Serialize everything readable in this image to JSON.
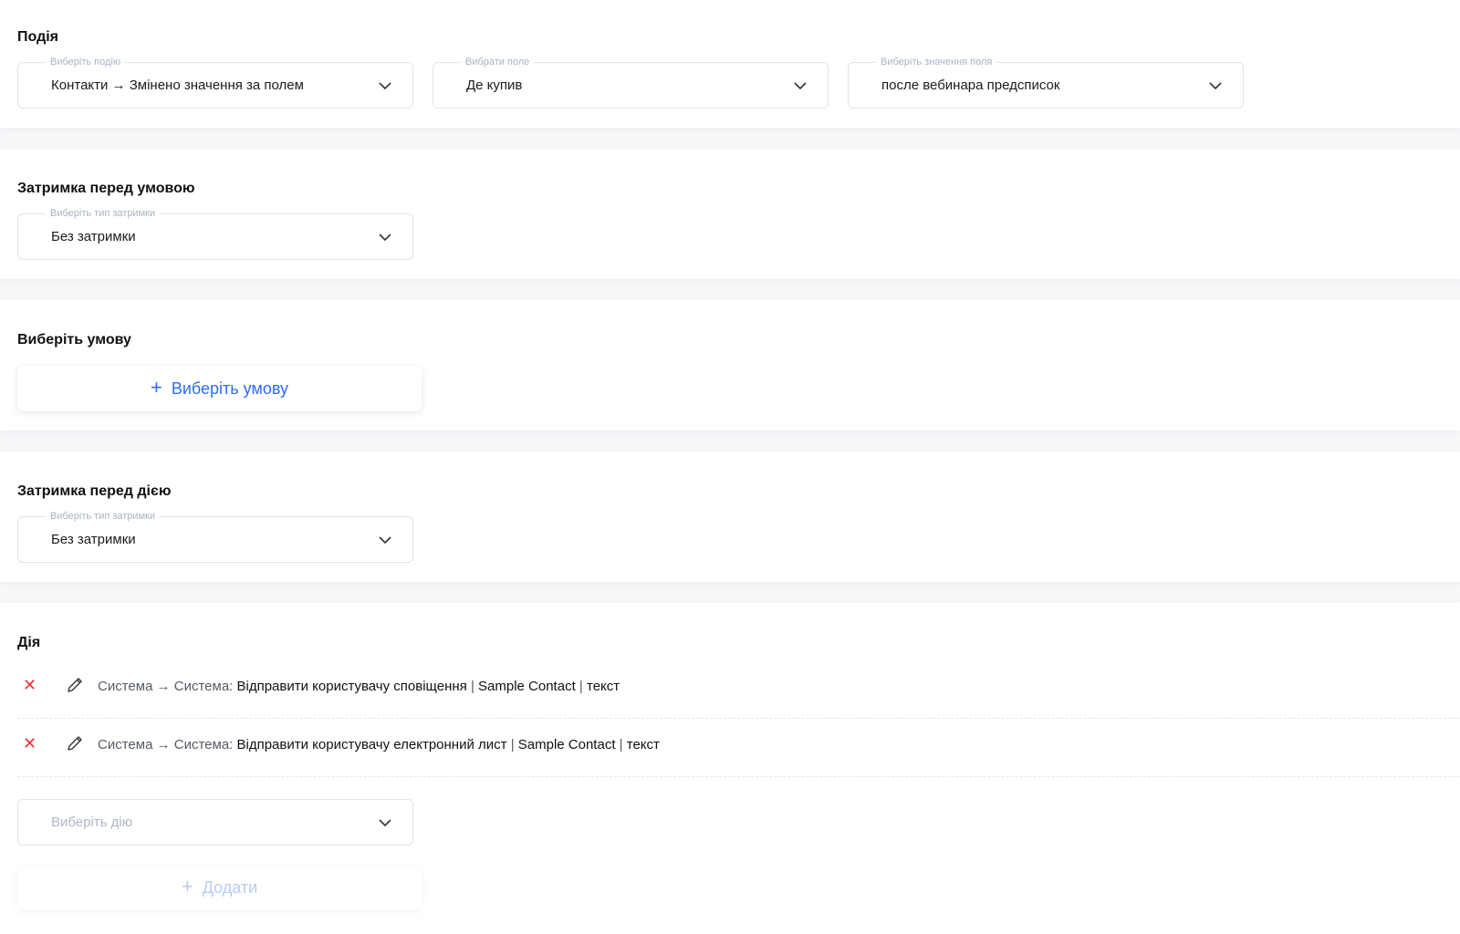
{
  "event": {
    "title": "Подія",
    "select_event": {
      "label": "Виберіть подію",
      "value": "Контакти → Змінено значення за полем"
    },
    "select_field": {
      "label": "Вибрати поле",
      "value": "Де купив"
    },
    "select_field_value": {
      "label": "Виберіть значення поля",
      "value": "после вебинара предсписок"
    }
  },
  "delay_before_condition": {
    "title": "Затримка перед умовою",
    "select": {
      "label": "Виберіть тип затримки",
      "value": "Без затримки"
    }
  },
  "condition": {
    "title": "Виберіть умову",
    "button_icon": "+",
    "button_label": "Виберіть умову"
  },
  "delay_before_action": {
    "title": "Затримка перед дією",
    "select": {
      "label": "Виберіть тип затримки",
      "value": "Без затримки"
    }
  },
  "action": {
    "title": "Дія",
    "items": [
      {
        "delete_icon": "✕",
        "prefix": "Система → Система:",
        "name": "Відправити користувачу сповіщення",
        "sep1": "|",
        "contact": "Sample Contact",
        "sep2": "|",
        "text": "текст"
      },
      {
        "delete_icon": "✕",
        "prefix": "Система → Система:",
        "name": "Відправити користувачу електронний лист",
        "sep1": "|",
        "contact": "Sample Contact",
        "sep2": "|",
        "text": "текст"
      }
    ],
    "select_action_placeholder": "Виберіть дію",
    "add_icon": "+",
    "add_label": "Додати"
  },
  "colors": {
    "accent_blue": "#2f6cf4",
    "delete_red": "#e5343a",
    "disabled_blue": "#b9cbf6"
  }
}
